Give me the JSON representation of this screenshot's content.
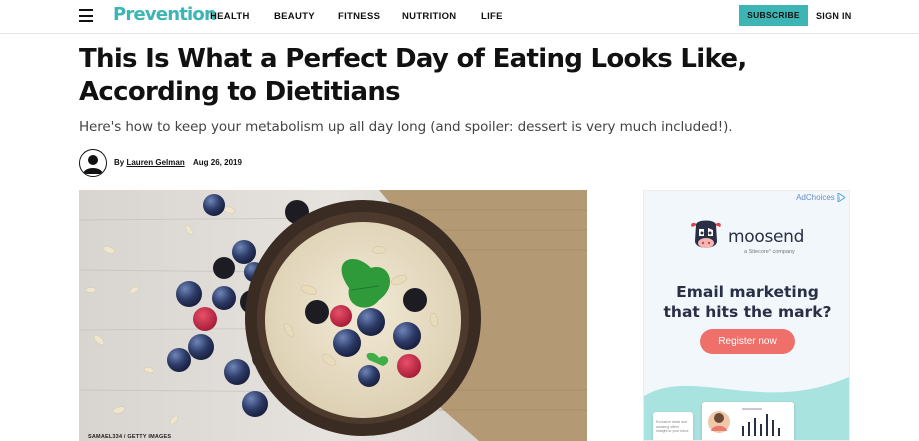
{
  "header": {
    "logo": "Prevention",
    "nav": [
      "HEALTH",
      "BEAUTY",
      "FITNESS",
      "NUTRITION",
      "LIFE"
    ],
    "subscribe_label": "SUBSCRIBE",
    "signin_label": "SIGN IN"
  },
  "article": {
    "title_line1": "This Is What a Perfect Day of Eating Looks Like,",
    "title_line2": "According to Dietitians",
    "dek": "Here's how to keep your metabolism up all day long (and spoiler: dessert is very much included!).",
    "by": "By",
    "author": "Lauren Gelman",
    "date": "Aug 26, 2019",
    "image_credit": "SAMAEL334 / GETTY IMAGES"
  },
  "ad": {
    "adchoices": "AdChoices",
    "brand": "moosend",
    "tagline": "a Sitecore° company",
    "headline_line1": "Email marketing",
    "headline_line2": "that hits the mark?",
    "cta": "Register now",
    "card_text": "Exclusive deals and amazing offers straight to your inbox"
  },
  "colors": {
    "brand_teal": "#3cb5b4",
    "ad_cta": "#ef6f6a",
    "ad_text": "#2a2f45"
  }
}
